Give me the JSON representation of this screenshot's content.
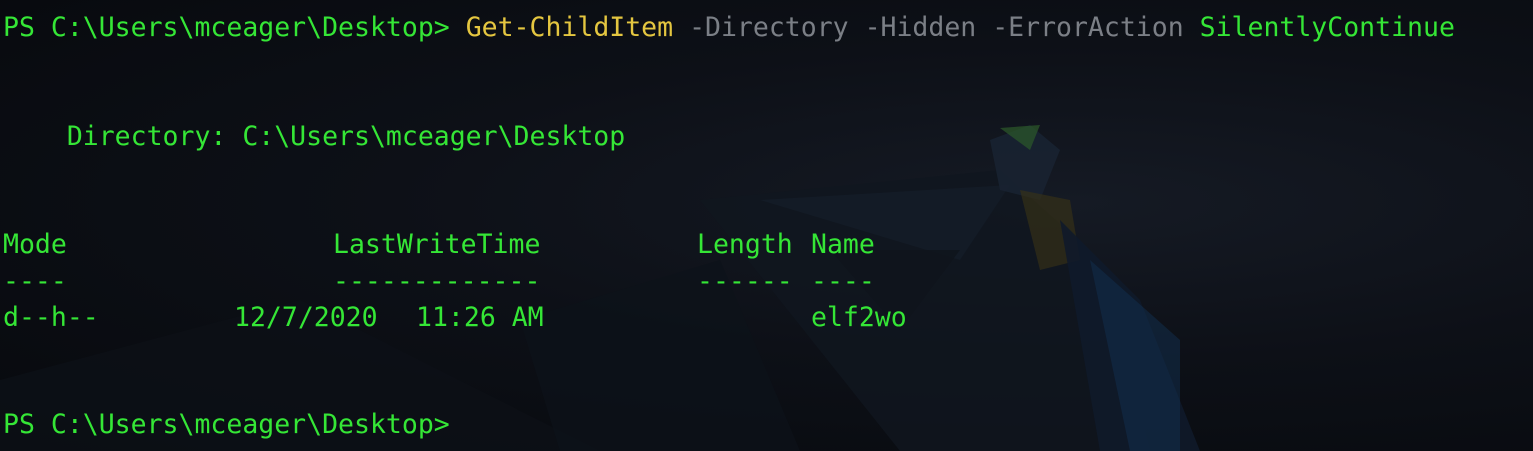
{
  "terminal": {
    "line1": {
      "prompt": "PS C:\\Users\\mceager\\Desktop> ",
      "command": "Get-ChildItem",
      "param1": " -Directory",
      "param2": " -Hidden",
      "param3": " -ErrorAction",
      "value": " SilentlyContinue"
    },
    "directory_line": "    Directory: C:\\Users\\mceager\\Desktop",
    "headers": {
      "mode": "Mode",
      "lastwritetime": "LastWriteTime",
      "length": "Length",
      "name": "Name"
    },
    "separators": {
      "mode": "----",
      "lastwritetime": "-------------",
      "length": "------",
      "name": "----"
    },
    "rows": [
      {
        "mode": "d--h--",
        "date": "12/7/2020",
        "time": "11:26 AM",
        "length": "",
        "name": "elf2wo"
      }
    ],
    "final_prompt": "PS C:\\Users\\mceager\\Desktop> "
  },
  "colors": {
    "prompt_green": "#35e636",
    "command_yellow": "#e4c640",
    "param_gray": "#7b7f86",
    "background": "#0b0d12"
  }
}
